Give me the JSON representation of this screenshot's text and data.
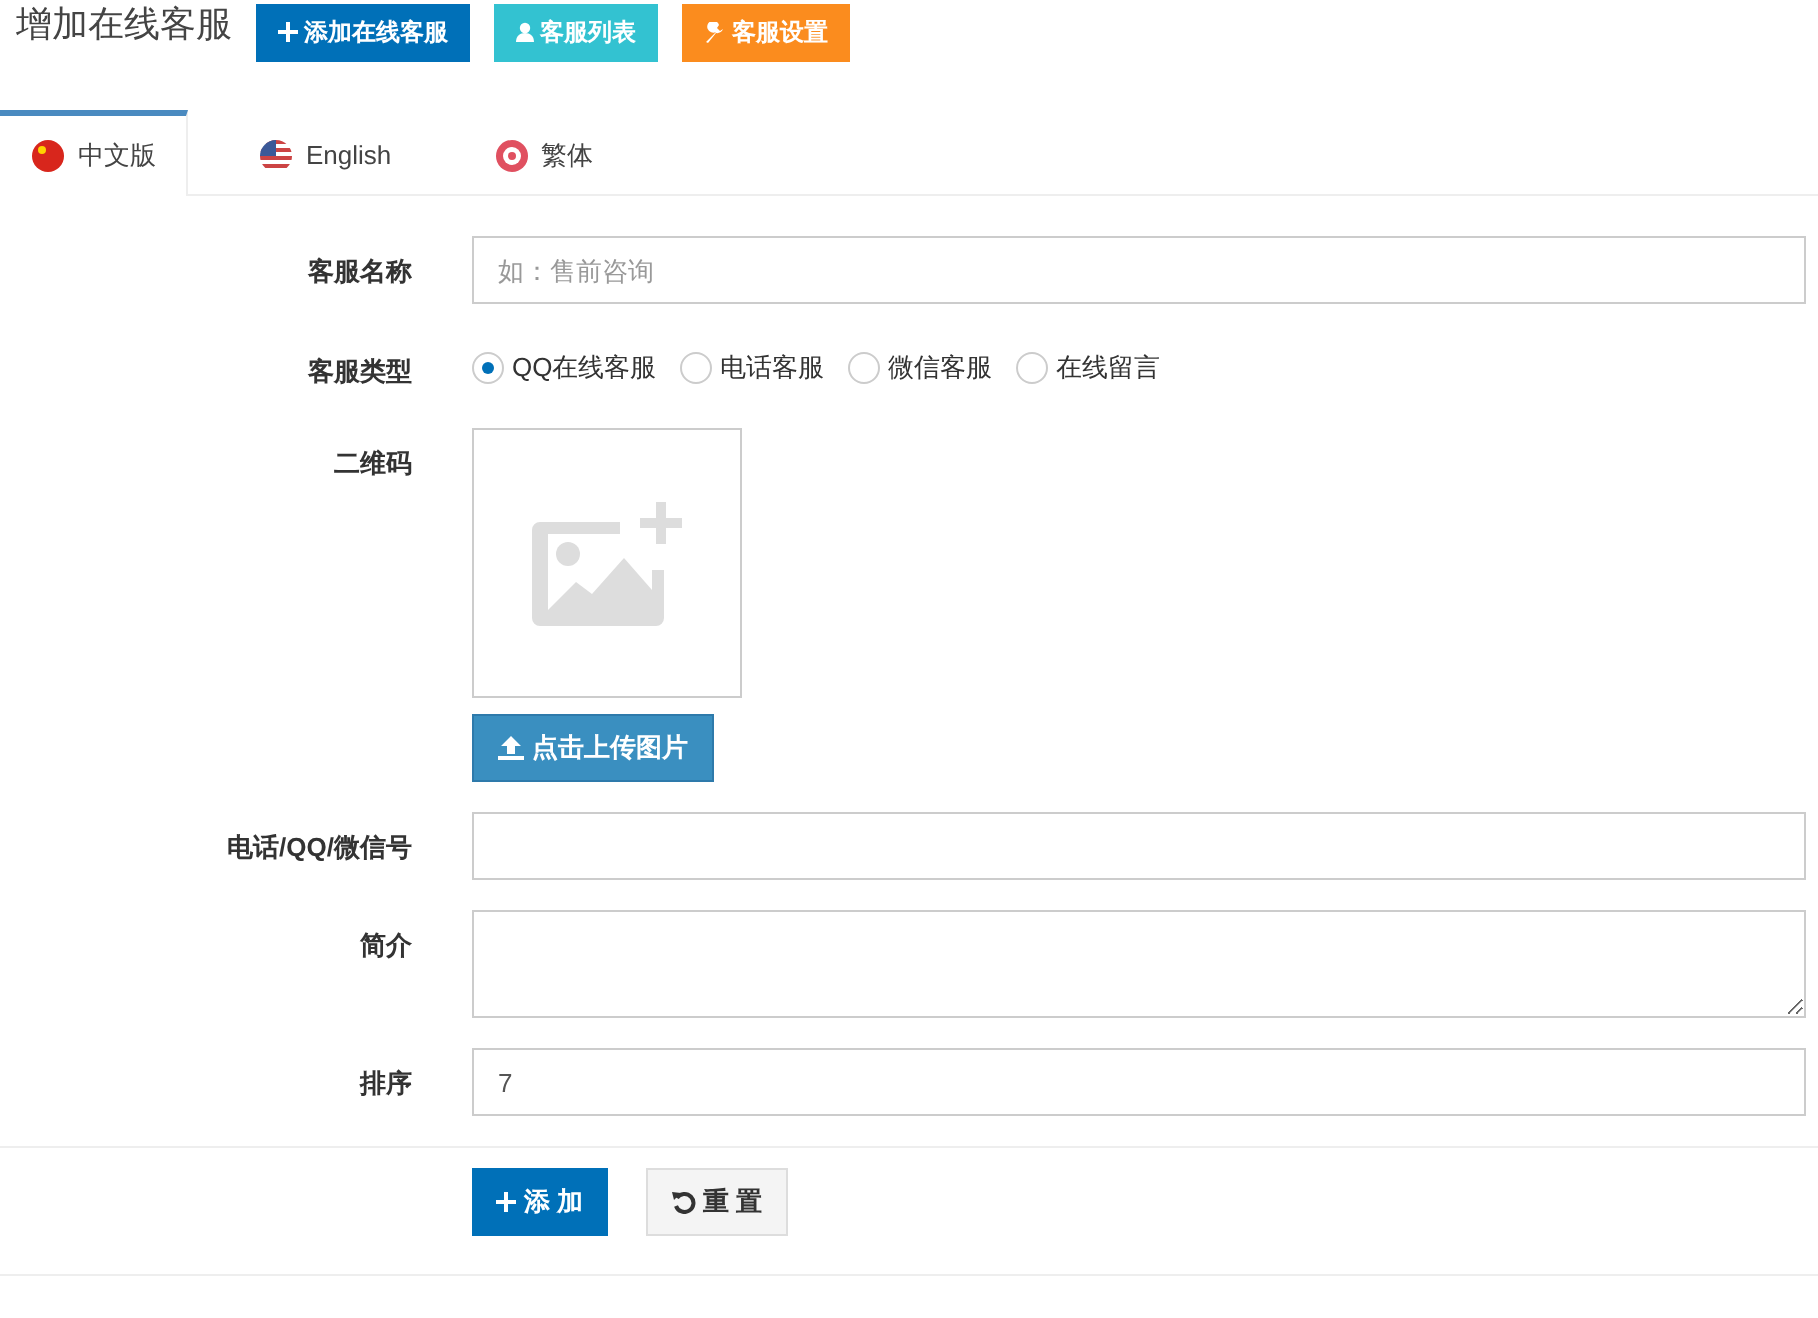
{
  "header": {
    "title": "增加在线客服",
    "buttons": [
      {
        "label": "添加在线客服",
        "color": "#0070b8"
      },
      {
        "label": "客服列表",
        "color": "#33c2d1"
      },
      {
        "label": "客服设置",
        "color": "#fb8c1e"
      }
    ]
  },
  "tabs": [
    {
      "label": "中文版",
      "selected": true
    },
    {
      "label": "English",
      "selected": false
    },
    {
      "label": "繁体",
      "selected": false
    }
  ],
  "form": {
    "fields": [
      {
        "kind": "text",
        "label": "客服名称",
        "placeholder": "如：售前咨询"
      },
      {
        "kind": "radio",
        "label": "客服类型",
        "options": [
          {
            "label": "QQ在线客服",
            "selected": true
          },
          {
            "label": "电话客服",
            "selected": false
          },
          {
            "label": "微信客服",
            "selected": false
          },
          {
            "label": "在线留言",
            "selected": false
          }
        ]
      },
      {
        "kind": "image",
        "label": "二维码",
        "button": "点击上传图片"
      },
      {
        "kind": "text",
        "label": "电话/QQ/微信号"
      },
      {
        "kind": "textarea",
        "label": "简介"
      },
      {
        "kind": "text",
        "label": "排序",
        "value": "7"
      }
    ],
    "actions": [
      {
        "kind": "primary",
        "label": "添 加"
      },
      {
        "kind": "default",
        "label": "重 置"
      }
    ]
  }
}
